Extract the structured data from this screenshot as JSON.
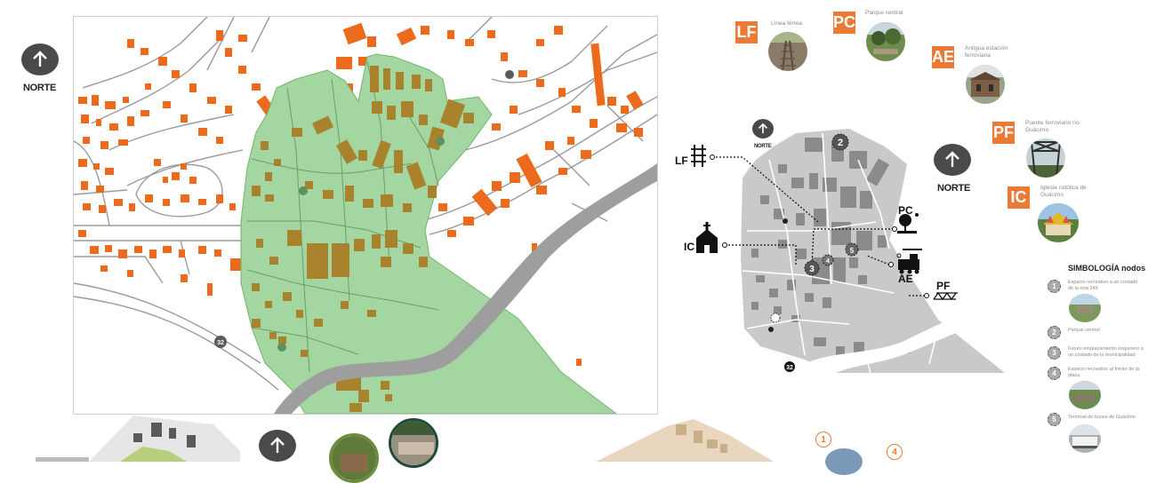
{
  "main_map": {
    "north_label": "NORTE",
    "route_badge": "32"
  },
  "inset_map": {
    "north_label_small": "NORTE",
    "north_label_large": "NORTE",
    "route_badge": "32",
    "node_labels": {
      "lf": "LF",
      "ic": "IC",
      "pc": "PC",
      "ae": "AE",
      "pf": "PF"
    },
    "node_numbers": [
      "2",
      "3",
      "4",
      "5"
    ]
  },
  "legend_photos": [
    {
      "code": "LF",
      "caption": "Línea férrea"
    },
    {
      "code": "PC",
      "caption": "Parque central"
    },
    {
      "code": "AE",
      "caption": "Antigua estación ferroviaria"
    },
    {
      "code": "PF",
      "caption": "Puente ferroviario río Guácimo"
    },
    {
      "code": "IC",
      "caption": "Iglesia católica de Guácimo"
    }
  ],
  "symbology": {
    "title": "SIMBOLOGÍA nodos",
    "items": [
      {
        "num": "1",
        "text": "Espacio recreativo a un costado de la ruta 249"
      },
      {
        "num": "2",
        "text": "Parque central"
      },
      {
        "num": "3",
        "text": "Futuro emplazamiento esquinero a un costado de la municipalidad"
      },
      {
        "num": "4",
        "text": "Espacio recreativo al frente de la plaza"
      },
      {
        "num": "5",
        "text": "Terminal de buses de Guácimo"
      }
    ]
  },
  "bottom": {
    "num1": "1",
    "num4": "4"
  },
  "colors": {
    "accent": "#ec7a35",
    "green_zone": "#a3d6a0",
    "building_orange": "#ec6a1c",
    "building_brown": "#a8822c",
    "inset_gray": "#c9c9c7"
  }
}
